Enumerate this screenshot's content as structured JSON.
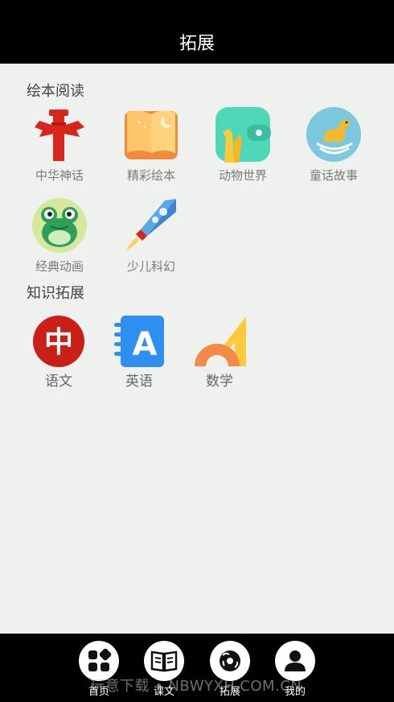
{
  "header": {
    "title": "拓展"
  },
  "sections": [
    {
      "title": "绘本阅读"
    },
    {
      "title": "知识拓展"
    }
  ],
  "picture_books": [
    {
      "label": "中华神话",
      "icon": "totem-icon"
    },
    {
      "label": "精彩绘本",
      "icon": "picture-book-icon"
    },
    {
      "label": "动物世界",
      "icon": "giraffe-icon"
    },
    {
      "label": "童话故事",
      "icon": "rocking-horse-icon"
    },
    {
      "label": "经典动画",
      "icon": "frog-icon"
    },
    {
      "label": "少儿科幻",
      "icon": "rocket-icon"
    }
  ],
  "knowledge": [
    {
      "label": "语文",
      "icon": "chinese-icon",
      "glyph": "中"
    },
    {
      "label": "英语",
      "icon": "english-icon",
      "glyph": "A"
    },
    {
      "label": "数学",
      "icon": "math-icon"
    }
  ],
  "tabs": [
    {
      "label": "首页",
      "icon": "home-grid-icon"
    },
    {
      "label": "课文",
      "icon": "book-icon"
    },
    {
      "label": "拓展",
      "icon": "ball-icon"
    },
    {
      "label": "我的",
      "icon": "user-icon"
    }
  ],
  "watermark": "玩意下载 • NBWYXH.COM.CN",
  "colors": {
    "header_bg": "#000000",
    "page_bg": "#eef1ee",
    "red": "#d9261c",
    "orange": "#f5a623",
    "teal": "#4fd8b8",
    "sky": "#6cc4dc",
    "blue": "#2e8ff0"
  }
}
